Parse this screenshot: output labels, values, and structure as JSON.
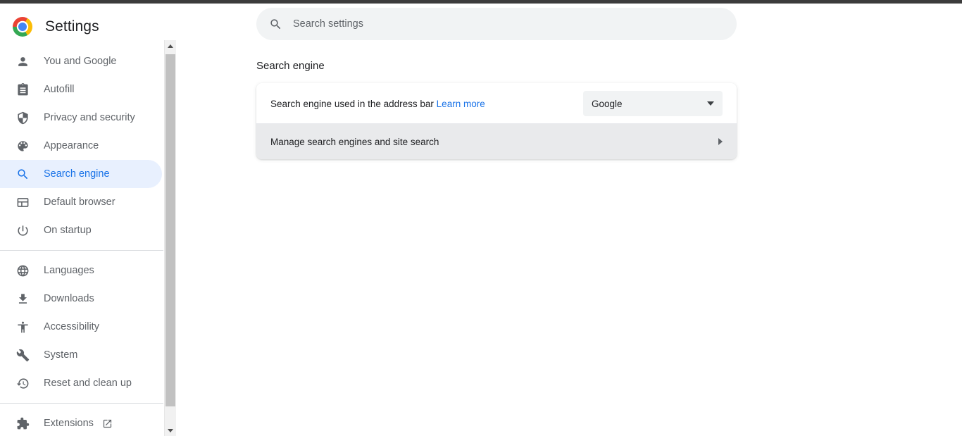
{
  "window": {
    "title": "Settings"
  },
  "brand": {
    "logo_name": "chrome-logo",
    "title": "Settings",
    "colors": {
      "red": "#ea4335",
      "yellow": "#fbbc05",
      "green": "#34a853",
      "blue": "#4285f4"
    }
  },
  "sidebar": {
    "groups": [
      {
        "items": [
          {
            "label": "You and Google",
            "icon": "person-icon",
            "name": "you-and-google",
            "selected": false
          },
          {
            "label": "Autofill",
            "icon": "clipboard-icon",
            "name": "autofill",
            "selected": false
          },
          {
            "label": "Privacy and security",
            "icon": "shield-icon",
            "name": "privacy-and-security",
            "selected": false
          },
          {
            "label": "Appearance",
            "icon": "palette-icon",
            "name": "appearance",
            "selected": false
          },
          {
            "label": "Search engine",
            "icon": "search-icon",
            "name": "search-engine",
            "selected": true
          },
          {
            "label": "Default browser",
            "icon": "browser-window-icon",
            "name": "default-browser",
            "selected": false
          },
          {
            "label": "On startup",
            "icon": "power-icon",
            "name": "on-startup",
            "selected": false
          }
        ]
      },
      {
        "items": [
          {
            "label": "Languages",
            "icon": "globe-icon",
            "name": "languages",
            "selected": false
          },
          {
            "label": "Downloads",
            "icon": "download-icon",
            "name": "downloads",
            "selected": false
          },
          {
            "label": "Accessibility",
            "icon": "accessibility-icon",
            "name": "accessibility",
            "selected": false
          },
          {
            "label": "System",
            "icon": "wrench-icon",
            "name": "system",
            "selected": false
          },
          {
            "label": "Reset and clean up",
            "icon": "history-restore-icon",
            "name": "reset-and-clean-up",
            "selected": false
          }
        ]
      },
      {
        "items": [
          {
            "label": "Extensions",
            "icon": "puzzle-piece-icon",
            "name": "extensions",
            "selected": false,
            "external": true
          }
        ]
      }
    ],
    "selected_colors": {
      "background": "#e8f0fe",
      "text": "#1a73e8"
    }
  },
  "scrollbar": {
    "up_arrow": "scroll-up-arrow",
    "down_arrow": "scroll-down-arrow",
    "thumb": "scroll-thumb"
  },
  "search": {
    "placeholder": "Search settings",
    "value": "",
    "icon": "search-icon"
  },
  "main": {
    "section_title": "Search engine",
    "rows": [
      {
        "label": "Search engine used in the address bar",
        "link_label": "Learn more",
        "control": "dropdown",
        "selected_value": "Google"
      },
      {
        "label": "Manage search engines and site search",
        "control": "chevron"
      }
    ]
  }
}
